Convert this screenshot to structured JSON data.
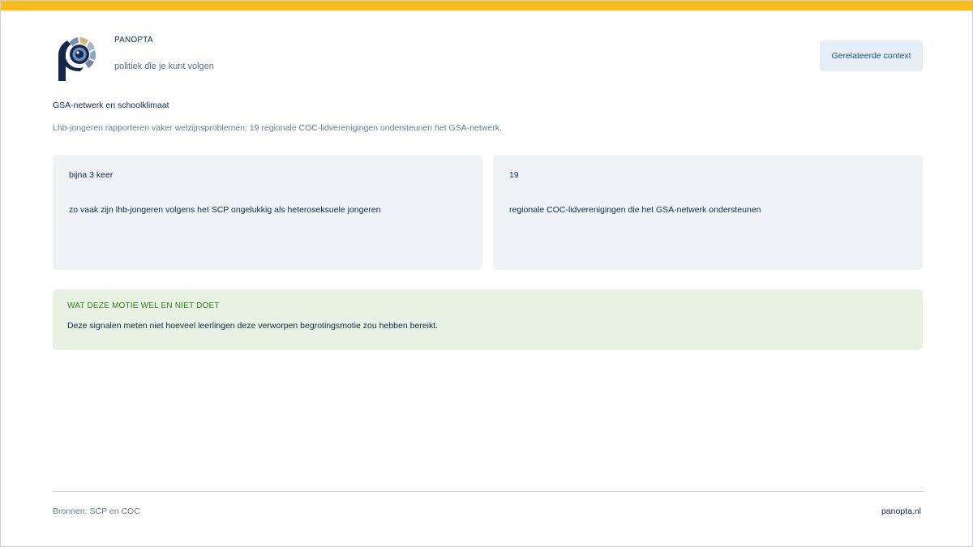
{
  "header": {
    "brand": "PANOPTA",
    "tagline": "politiek die je kunt volgen",
    "context_button": "Gerelateerde context",
    "logo_icon": "panopta-eye-logo-icon"
  },
  "main": {
    "title": "GSA-netwerk en schoolklimaat",
    "subtitle": "Lhb-jongeren rapporteren vaker welzijnsproblemen; 19 regionale COC-lidverenigingen ondersteunen het GSA-netwerk.",
    "stats": [
      {
        "value": "bijna 3 keer",
        "description": "zo vaak zijn lhb-jongeren volgens het SCP ongelukkig als heteroseksuele jongeren"
      },
      {
        "value": "19",
        "description": "regionale COC-lidverenigingen die het GSA-netwerk ondersteunen"
      }
    ],
    "note": {
      "label": "WAT DEZE MOTIE WEL EN NIET DOET",
      "text": "Deze signalen meten niet hoeveel leerlingen deze verworpen begrotingsmotie zou hebben bereikt."
    }
  },
  "footer": {
    "sources": "Bronnen: SCP en COC",
    "site": "panopta.nl"
  },
  "colors": {
    "accent_bar": "#fbbd1e",
    "navy": "#16264a",
    "card_bg": "#eff3f7",
    "note_bg": "#e7f2e3",
    "note_label": "#3b7a1f"
  }
}
